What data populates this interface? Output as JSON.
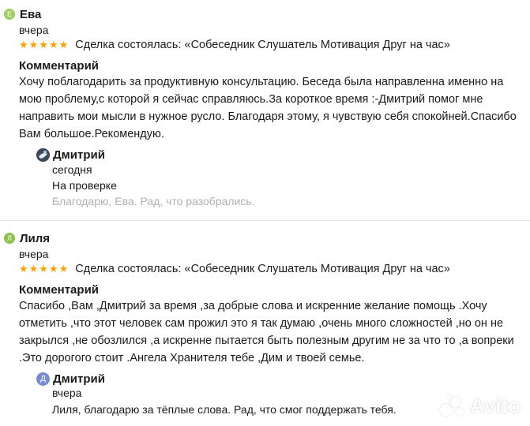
{
  "reviews": [
    {
      "author": "Ева",
      "avatar_letter": "Е",
      "avatar_color": "#9ccf5b",
      "date": "вчера",
      "rating": 5,
      "stars": "★★★★★",
      "deal": "Сделка состоялась: «Собеседник Слушатель Мотивация Друг на час»",
      "comment_label": "Комментарий",
      "comment": "Хочу поблагодарить за продуктивную консультацию. Беседа была направленна именно на мою проблему,с которой я сейчас справляюсь.За короткое время :-Дмитрий помог мне направить мои мысли в нужное русло. Благодаря этому, я чувствую себя спокойней.Спасибо Вам большое.Рекомендую.",
      "reply": {
        "author": "Дмитрий",
        "date": "сегодня",
        "status": "На проверке",
        "text": "Благодарю, Ева. Рад, что разобрались."
      }
    },
    {
      "author": "Лиля",
      "avatar_letter": "Л",
      "avatar_color": "#8bc34a",
      "date": "вчера",
      "rating": 5,
      "stars": "★★★★★",
      "deal": "Сделка состоялась: «Собеседник Слушатель Мотивация Друг на час»",
      "comment_label": "Комментарий",
      "comment": "Спасибо ,Вам ,Дмитрий за время ,за добрые слова и искренние желание помощь .Хочу отметить ,что этот человек сам прожил это я так думаю ,очень много сложностей ,но он не закрылся ,не обозлился ,а искренне пытается быть полезным другим не за что то ,а вопреки .Это дорогого стоит .Ангела Хранителя тебе ,Дим и твоей семье.",
      "reply": {
        "author": "Дмитрий",
        "avatar_letter": "Д",
        "avatar_color": "#7a8bd4",
        "date": "вчера",
        "text": "Лиля, благодарю за тёплые слова. Рад, что смог поддержать тебя."
      }
    }
  ],
  "watermark": "Avito"
}
